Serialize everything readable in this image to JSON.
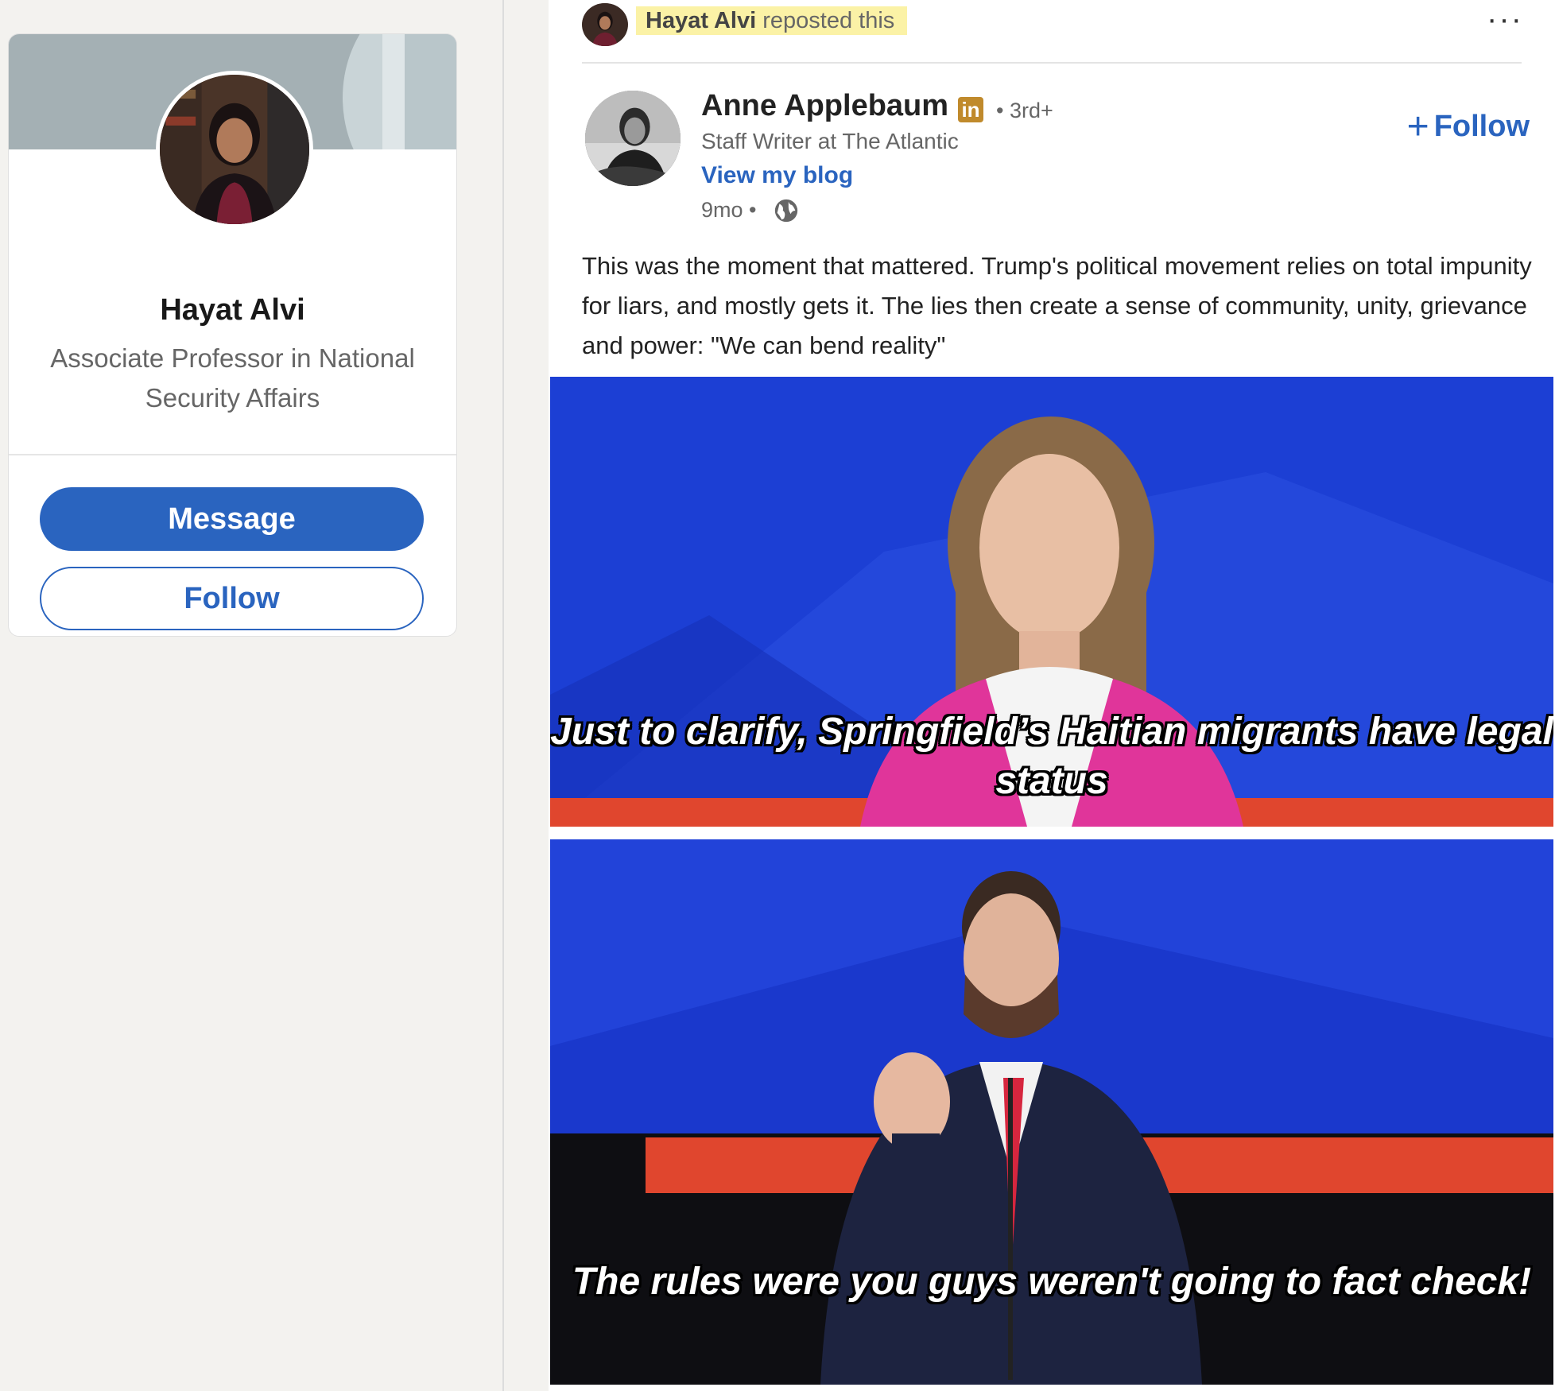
{
  "profile": {
    "name": "Hayat Alvi",
    "headline": "Associate Professor in National Security Affairs",
    "message_label": "Message",
    "follow_label": "Follow"
  },
  "repost": {
    "user": "Hayat Alvi",
    "action": "reposted this",
    "more_label": "···"
  },
  "post": {
    "author": "Anne Applebaum",
    "premium_badge": "in",
    "degree": "• 3rd+",
    "headline": "Staff Writer at The Atlantic",
    "link_label": "View my blog",
    "time": "9mo •",
    "follow_label": "Follow",
    "text": "This was the moment that mattered. Trump's political movement relies on total impunity for liars, and mostly gets it. The lies then create a sense of community, unity, grievance and power: \"We can bend reality\"",
    "media": {
      "caption_top": "Just to clarify, Springfield’s Haitian migrants have legal status",
      "caption_bottom": "The rules were you guys weren't going to fact check!"
    }
  },
  "colors": {
    "accent": "#2a64bf",
    "repost_highlight": "#fbf2a6",
    "premium": "#c08a2c",
    "stage_blue": "#1c3fd4"
  }
}
